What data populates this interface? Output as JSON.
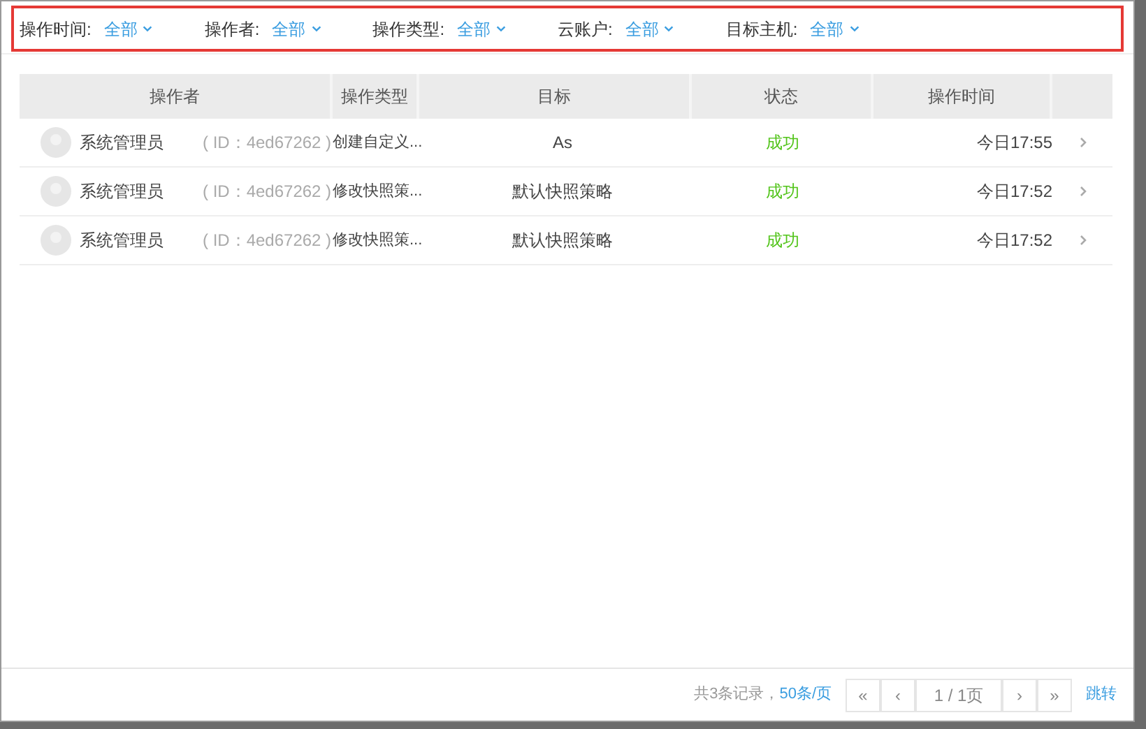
{
  "filters": [
    {
      "label": "操作时间:",
      "value": "全部"
    },
    {
      "label": "操作者:",
      "value": "全部"
    },
    {
      "label": "操作类型:",
      "value": "全部"
    },
    {
      "label": "云账户:",
      "value": "全部"
    },
    {
      "label": "目标主机:",
      "value": "全部"
    }
  ],
  "table": {
    "columns": [
      "操作者",
      "操作类型",
      "目标",
      "状态",
      "操作时间"
    ],
    "rows": [
      {
        "operator": "系统管理员",
        "operator_id": "( ID：4ed67262 )",
        "type": "创建自定义...",
        "target": "As",
        "status": {
          "text": "成功",
          "color": "#52c41a"
        },
        "time": "今日17:55"
      },
      {
        "operator": "系统管理员",
        "operator_id": "( ID：4ed67262 )",
        "type": "修改快照策...",
        "target": "默认快照策略",
        "status": {
          "text": "成功",
          "color": "#52c41a"
        },
        "time": "今日17:52"
      },
      {
        "operator": "系统管理员",
        "operator_id": "( ID：4ed67262 )",
        "type": "修改快照策...",
        "target": "默认快照策略",
        "status": {
          "text": "成功",
          "color": "#52c41a"
        },
        "time": "今日17:52"
      }
    ]
  },
  "pagination": {
    "total": "共3条记录，",
    "page_size": "50条/页",
    "first": "«",
    "prev": "‹",
    "page": "1 / 1页",
    "next": "›",
    "last": "»",
    "jump": "跳转"
  }
}
